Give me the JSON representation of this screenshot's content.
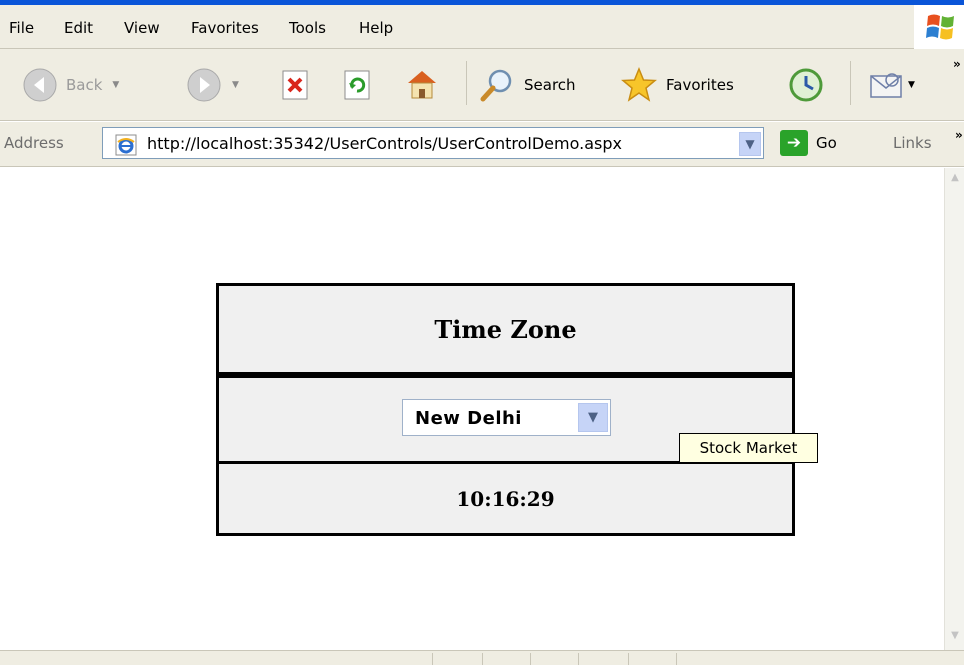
{
  "menu": {
    "items": [
      {
        "label": "File"
      },
      {
        "label": "Edit"
      },
      {
        "label": "View"
      },
      {
        "label": "Favorites"
      },
      {
        "label": "Tools"
      },
      {
        "label": "Help"
      }
    ]
  },
  "toolbar": {
    "back_label": "Back",
    "search_label": "Search",
    "favorites_label": "Favorites",
    "icons": [
      "back-icon",
      "forward-icon",
      "stop-icon",
      "refresh-icon",
      "home-icon",
      "search-icon",
      "favorites-star-icon",
      "history-icon",
      "mail-icon"
    ]
  },
  "address": {
    "label": "Address",
    "url": "http://localhost:35342/UserControls/UserControlDemo.aspx",
    "go_label": "Go",
    "links_label": "Links"
  },
  "widget": {
    "title": "Time Zone",
    "selected_city": "New Delhi",
    "time": "10:16:29",
    "tooltip": "Stock Market"
  },
  "colors": {
    "chrome_bg": "#efede2",
    "table_bg": "#f0f0f0",
    "tooltip_bg": "#ffffe1",
    "dropdown_button": "#c6d4f7"
  }
}
